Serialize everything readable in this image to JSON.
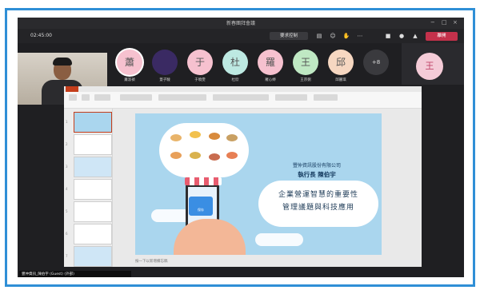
{
  "window": {
    "title": "新春團拜會議",
    "minimize": "−",
    "maximize": "□",
    "close": "×"
  },
  "toolbar": {
    "elapsed": "02:45:00",
    "control_button": "要求控制",
    "leave_button": "離開",
    "icons": [
      "chat-icon",
      "reactions-icon",
      "raise-hand-icon",
      "more-icon",
      "camera-icon",
      "mic-icon",
      "share-icon"
    ]
  },
  "participants": [
    {
      "initial": "蕭",
      "name": "蕭淑禎",
      "color": "#f6c1cf",
      "selected": true
    },
    {
      "initial": "",
      "name": "蓋子駿",
      "color": "#3a2a63",
      "selected": false
    },
    {
      "initial": "于",
      "name": "于曉雯",
      "color": "#f6c1cf",
      "selected": false
    },
    {
      "initial": "杜",
      "name": "杜欣",
      "color": "#bde9e2",
      "selected": false
    },
    {
      "initial": "羅",
      "name": "羅心婷",
      "color": "#f6c1cf",
      "selected": false
    },
    {
      "initial": "王",
      "name": "王宗弼",
      "color": "#bfe8c3",
      "selected": false
    },
    {
      "initial": "邱",
      "name": "邱麗琪",
      "color": "#f6d7c1",
      "selected": false
    },
    {
      "initial": "+8",
      "name": "",
      "color": "#3a3a3e",
      "selected": false
    }
  ],
  "right_avatar": {
    "initial": "王"
  },
  "presentation": {
    "slide_count": 7,
    "current_slide": 1,
    "company": "豐仲資訊股份有限公司",
    "executive": "執行長 陳伯宇",
    "title_line1": "企業營運智慧的重要性",
    "title_line2": "管理議題與科技應用",
    "app_label": "保存",
    "notes_placeholder": "按一下以新增備忘稿"
  },
  "presenter": {
    "label": "豐仲資訊_陳伯宇 (Guest) (外部)"
  }
}
